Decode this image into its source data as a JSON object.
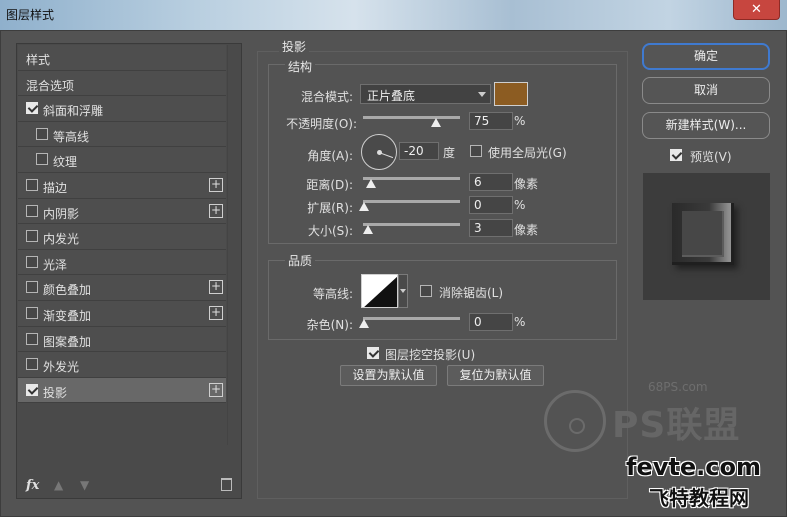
{
  "window": {
    "title": "图层样式",
    "close_label": "✕"
  },
  "styles_list": {
    "items": [
      {
        "label": "样式",
        "checkbox": false,
        "checked": false,
        "plus": false,
        "indent": false,
        "selected": false
      },
      {
        "label": "混合选项",
        "checkbox": false,
        "checked": false,
        "plus": false,
        "indent": false,
        "selected": false
      },
      {
        "label": "斜面和浮雕",
        "checkbox": true,
        "checked": true,
        "plus": false,
        "indent": false,
        "selected": false
      },
      {
        "label": "等高线",
        "checkbox": true,
        "checked": false,
        "plus": false,
        "indent": true,
        "selected": false
      },
      {
        "label": "纹理",
        "checkbox": true,
        "checked": false,
        "plus": false,
        "indent": true,
        "selected": false
      },
      {
        "label": "描边",
        "checkbox": true,
        "checked": false,
        "plus": true,
        "indent": false,
        "selected": false
      },
      {
        "label": "内阴影",
        "checkbox": true,
        "checked": false,
        "plus": true,
        "indent": false,
        "selected": false
      },
      {
        "label": "内发光",
        "checkbox": true,
        "checked": false,
        "plus": false,
        "indent": false,
        "selected": false
      },
      {
        "label": "光泽",
        "checkbox": true,
        "checked": false,
        "plus": false,
        "indent": false,
        "selected": false
      },
      {
        "label": "颜色叠加",
        "checkbox": true,
        "checked": false,
        "plus": true,
        "indent": false,
        "selected": false
      },
      {
        "label": "渐变叠加",
        "checkbox": true,
        "checked": false,
        "plus": true,
        "indent": false,
        "selected": false
      },
      {
        "label": "图案叠加",
        "checkbox": true,
        "checked": false,
        "plus": false,
        "indent": false,
        "selected": false
      },
      {
        "label": "外发光",
        "checkbox": true,
        "checked": false,
        "plus": false,
        "indent": false,
        "selected": false
      },
      {
        "label": "投影",
        "checkbox": true,
        "checked": true,
        "plus": true,
        "indent": false,
        "selected": true
      }
    ],
    "footer": {
      "fx_label": "fx",
      "up_icon": "▲",
      "down_icon": "▼"
    }
  },
  "drop_shadow": {
    "title": "投影",
    "structure": {
      "title": "结构",
      "blend_mode_label": "混合模式:",
      "blend_mode_value": "正片叠底",
      "color": "#8c5c22",
      "opacity_label": "不透明度(O):",
      "opacity_value": "75",
      "opacity_unit": "%",
      "opacity_fraction": 0.75,
      "angle_label": "角度(A):",
      "angle_value": "-20",
      "angle_unit": "度",
      "global_light_label": "使用全局光(G)",
      "global_light_checked": false,
      "distance_label": "距离(D):",
      "distance_value": "6",
      "distance_unit": "像素",
      "spread_label": "扩展(R):",
      "spread_value": "0",
      "spread_unit": "%",
      "size_label": "大小(S):",
      "size_value": "3",
      "size_unit": "像素"
    },
    "quality": {
      "title": "品质",
      "contour_label": "等高线:",
      "anti_alias_label": "消除锯齿(L)",
      "anti_alias_checked": false,
      "noise_label": "杂色(N):",
      "noise_value": "0",
      "noise_unit": "%"
    },
    "knockout_label": "图层挖空投影(U)",
    "knockout_checked": true,
    "make_default_label": "设置为默认值",
    "reset_default_label": "复位为默认值"
  },
  "actions": {
    "ok_label": "确定",
    "cancel_label": "取消",
    "new_style_label": "新建样式(W)...",
    "preview_label": "预览(V)",
    "preview_checked": true
  },
  "watermarks": {
    "site_68": "68PS.com",
    "ps_logo_text": "PS联盟",
    "fevte": "fevte.com",
    "fevte_cn": "飞特教程网"
  }
}
